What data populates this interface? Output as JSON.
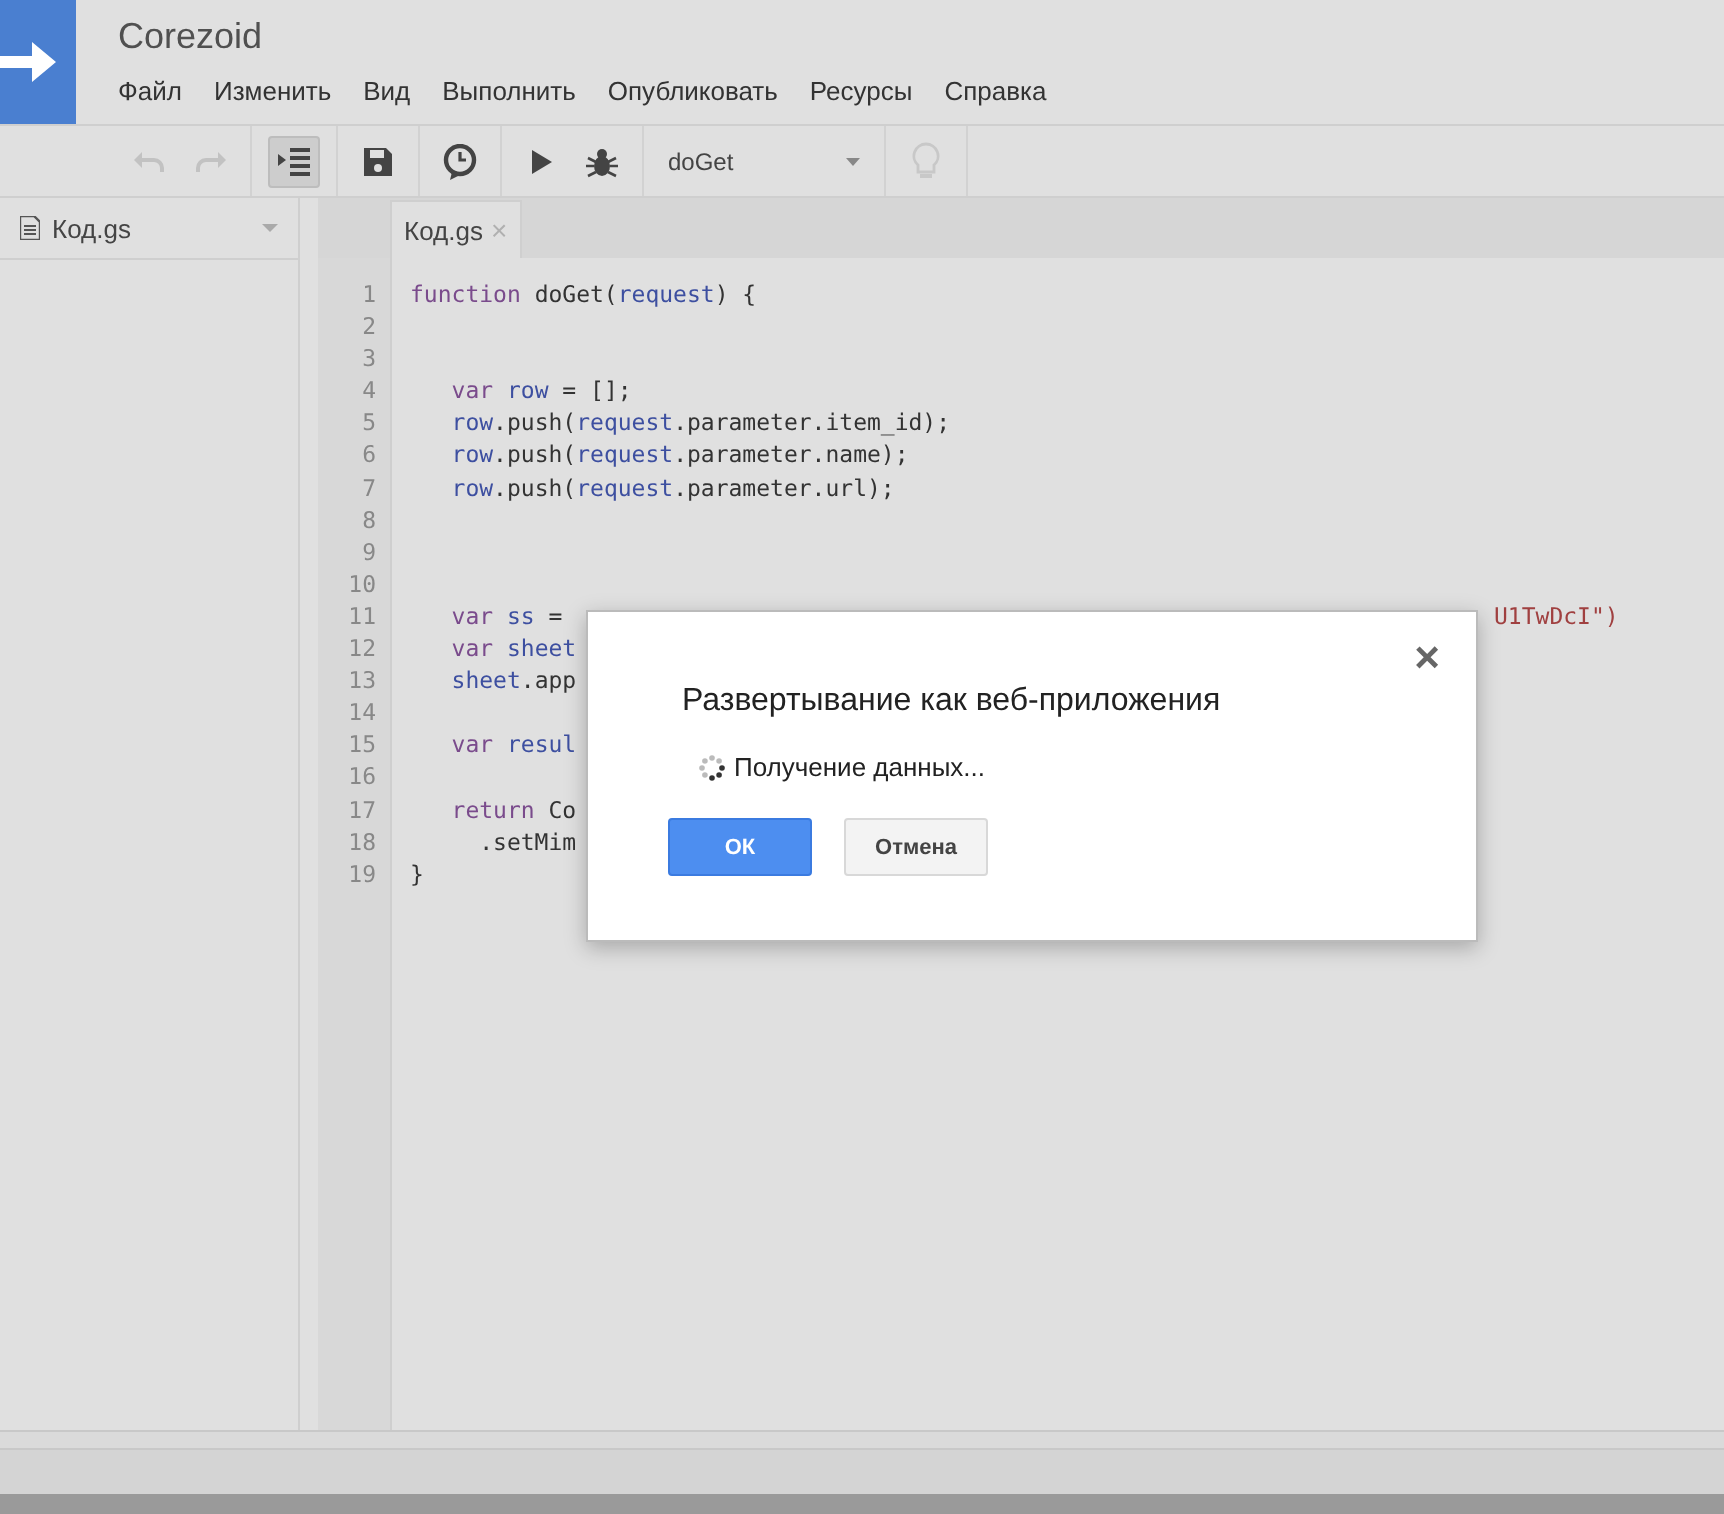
{
  "app": {
    "title": "Corezoid",
    "menu": [
      "Файл",
      "Изменить",
      "Вид",
      "Выполнить",
      "Опубликовать",
      "Ресурсы",
      "Справка"
    ]
  },
  "toolbar": {
    "function_select": "doGet"
  },
  "sidebar": {
    "files": [
      {
        "name": "Код.gs"
      }
    ]
  },
  "editor": {
    "tab": {
      "label": "Код.gs",
      "close": "×"
    },
    "lines": [
      {
        "number": "1",
        "parts": [
          {
            "kind": "keyword",
            "text": "function "
          },
          {
            "kind": "plain",
            "text": "doGet("
          },
          {
            "kind": "variable",
            "text": "request"
          },
          {
            "kind": "plain",
            "text": ") {"
          }
        ]
      },
      {
        "number": "2"
      },
      {
        "number": "3"
      },
      {
        "number": "4",
        "parts": [
          {
            "kind": "keyword",
            "text": "   var "
          },
          {
            "kind": "variable",
            "text": "row"
          },
          {
            "kind": "plain",
            "text": " = [];"
          }
        ]
      },
      {
        "number": "5",
        "parts": [
          {
            "kind": "variable",
            "text": "   row"
          },
          {
            "kind": "plain",
            "text": ".push("
          },
          {
            "kind": "variable",
            "text": "request"
          },
          {
            "kind": "plain",
            "text": ".parameter.item_id);"
          }
        ]
      },
      {
        "number": "6",
        "parts": [
          {
            "kind": "variable",
            "text": "   row"
          },
          {
            "kind": "plain",
            "text": ".push("
          },
          {
            "kind": "variable",
            "text": "request"
          },
          {
            "kind": "plain",
            "text": ".parameter.name);"
          }
        ]
      },
      {
        "number": "7",
        "parts": [
          {
            "kind": "variable",
            "text": "   row"
          },
          {
            "kind": "plain",
            "text": ".push("
          },
          {
            "kind": "variable",
            "text": "request"
          },
          {
            "kind": "plain",
            "text": ".parameter.url);"
          }
        ]
      },
      {
        "number": "8"
      },
      {
        "number": "9"
      },
      {
        "number": "10"
      },
      {
        "number": "11",
        "parts": [
          {
            "kind": "keyword",
            "text": "   var "
          },
          {
            "kind": "variable",
            "text": "ss"
          },
          {
            "kind": "plain",
            "text": " ="
          }
        ],
        "tail": "U1TwDcI\")"
      },
      {
        "number": "12",
        "parts": [
          {
            "kind": "keyword",
            "text": "   var "
          },
          {
            "kind": "variable",
            "text": "sheet"
          }
        ]
      },
      {
        "number": "13",
        "parts": [
          {
            "kind": "variable",
            "text": "   sheet"
          },
          {
            "kind": "plain",
            "text": ".app"
          }
        ]
      },
      {
        "number": "14"
      },
      {
        "number": "15",
        "parts": [
          {
            "kind": "keyword",
            "text": "   var "
          },
          {
            "kind": "variable",
            "text": "resul"
          }
        ]
      },
      {
        "number": "16"
      },
      {
        "number": "17",
        "parts": [
          {
            "kind": "keyword",
            "text": "   return "
          },
          {
            "kind": "plain",
            "text": "Co"
          }
        ]
      },
      {
        "number": "18",
        "parts": [
          {
            "kind": "plain",
            "text": "     .setMim"
          }
        ]
      },
      {
        "number": "19",
        "parts": [
          {
            "kind": "plain",
            "text": "}"
          }
        ]
      }
    ]
  },
  "dialog": {
    "title": "Развертывание как веб-приложения",
    "status": "Получение данных...",
    "close": "×",
    "buttons": [
      {
        "label": "ОК",
        "kind": "primary"
      },
      {
        "label": "Отмена",
        "kind": "secondary"
      }
    ]
  }
}
